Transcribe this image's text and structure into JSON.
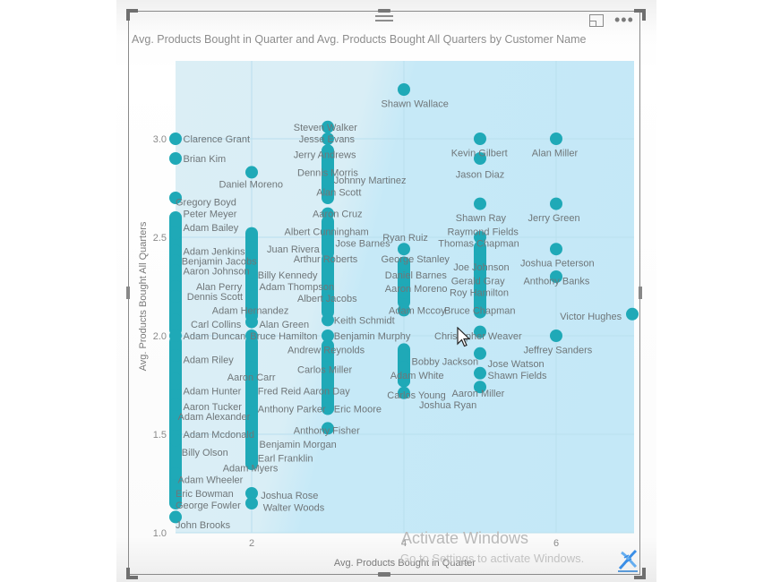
{
  "visual": {
    "title": "Avg. Products Bought in Quarter and Avg. Products Bought All Quarters by Customer Name",
    "header_icons": [
      "drag-handle-icon",
      "focus-mode-icon",
      "more-options-icon"
    ]
  },
  "watermark": {
    "line1": "Activate Windows",
    "line2": "Go to Settings to activate Windows."
  },
  "colors": {
    "marker": "#1fa9b7",
    "label": "#6f7679",
    "plot_background": "#c4e8f7"
  },
  "chart_data": {
    "type": "scatter",
    "title": "Avg. Products Bought in Quarter and Avg. Products Bought All Quarters by Customer Name",
    "xlabel": "Avg. Products Bought in Quarter",
    "ylabel": "Avg. Products Bought All Quarters",
    "xlim": [
      1,
      7
    ],
    "ylim": [
      1.0,
      3.3
    ],
    "x_ticks": [
      2,
      4,
      6
    ],
    "x_tick_labels": [
      "2",
      "4",
      "6"
    ],
    "y_ticks": [
      1.0,
      1.5,
      2.0,
      2.5,
      3.0
    ],
    "y_tick_labels": [
      "1.0",
      "1.5",
      "2.0",
      "2.5",
      "3.0"
    ],
    "grid": true,
    "legend": "none",
    "columns": [
      {
        "x": 1,
        "y_from": 2.03,
        "y_to": 2.6
      },
      {
        "x": 1,
        "y_from": 1.15,
        "y_to": 1.97
      },
      {
        "x": 2,
        "y_from": 2.1,
        "y_to": 2.52
      },
      {
        "x": 2,
        "y_from": 1.35,
        "y_to": 1.97
      },
      {
        "x": 3,
        "y_from": 2.7,
        "y_to": 2.92
      },
      {
        "x": 3,
        "y_from": 2.12,
        "y_to": 2.38
      },
      {
        "x": 3,
        "y_from": 1.63,
        "y_to": 1.95
      },
      {
        "x": 3,
        "y_from": 2.42,
        "y_to": 2.58
      },
      {
        "x": 4,
        "y_from": 2.17,
        "y_to": 2.37
      },
      {
        "x": 4,
        "y_from": 1.77,
        "y_to": 1.93
      },
      {
        "x": 5,
        "y_from": 2.12,
        "y_to": 2.45
      }
    ],
    "points": [
      {
        "name": "Clarence Grant",
        "x": 1,
        "y": 3.0
      },
      {
        "name": "Brian Kim",
        "x": 1,
        "y": 2.9
      },
      {
        "name": "Gregory Boyd",
        "x": 1,
        "y": 2.7
      },
      {
        "name": "Peter Meyer",
        "x": 1,
        "y": 2.58
      },
      {
        "name": "Adam Bailey",
        "x": 1,
        "y": 2.52
      },
      {
        "name": "Adam Jenkins",
        "x": 1,
        "y": 2.43
      },
      {
        "name": "Benjamin Jacobs",
        "x": 1,
        "y": 2.38
      },
      {
        "name": "Aaron Johnson",
        "x": 1,
        "y": 2.33
      },
      {
        "name": "Alan Perry",
        "x": 1,
        "y": 2.25
      },
      {
        "name": "Dennis Scott",
        "x": 1,
        "y": 2.2
      },
      {
        "name": "Adam Hernandez",
        "x": 2,
        "y": 2.13
      },
      {
        "name": "Carl Collins",
        "x": 1,
        "y": 2.08
      },
      {
        "name": "Adam Duncan",
        "x": 1,
        "y": 2.0
      },
      {
        "name": "Adam Riley",
        "x": 1,
        "y": 1.9
      },
      {
        "name": "Aaron Carr",
        "x": 2,
        "y": 1.84
      },
      {
        "name": "Adam Hunter",
        "x": 1,
        "y": 1.78
      },
      {
        "name": "Aaron Tucker",
        "x": 1,
        "y": 1.7
      },
      {
        "name": "Adam Alexander",
        "x": 1,
        "y": 1.65
      },
      {
        "name": "Adam Mcdonald",
        "x": 1,
        "y": 1.55
      },
      {
        "name": "Billy Olson",
        "x": 1,
        "y": 1.47
      },
      {
        "name": "Adam Myers",
        "x": 2,
        "y": 1.37
      },
      {
        "name": "Adam Wheeler",
        "x": 1,
        "y": 1.3
      },
      {
        "name": "Eric Bowman",
        "x": 1,
        "y": 1.24
      },
      {
        "name": "George Fowler",
        "x": 1,
        "y": 1.17
      },
      {
        "name": "John Brooks",
        "x": 1,
        "y": 1.08
      },
      {
        "name": "Daniel Moreno",
        "x": 2,
        "y": 2.83
      },
      {
        "name": "Juan Rivera",
        "x": 2,
        "y": 2.45
      },
      {
        "name": "Billy Kennedy",
        "x": 2,
        "y": 2.33
      },
      {
        "name": "Adam Thompson",
        "x": 2,
        "y": 2.26
      },
      {
        "name": "Alan Green",
        "x": 2,
        "y": 2.07
      },
      {
        "name": "Bruce Hamilton",
        "x": 2,
        "y": 2.0
      },
      {
        "name": "Fred Reid",
        "x": 2,
        "y": 1.78
      },
      {
        "name": "Anthony Parker",
        "x": 2,
        "y": 1.67
      },
      {
        "name": "Benjamin Morgan",
        "x": 2,
        "y": 1.46
      },
      {
        "name": "Earl Franklin",
        "x": 2,
        "y": 1.4
      },
      {
        "name": "Joshua Rose",
        "x": 2,
        "y": 1.2
      },
      {
        "name": "Walter Woods",
        "x": 2,
        "y": 1.15
      },
      {
        "name": "Steven Walker",
        "x": 3,
        "y": 3.06
      },
      {
        "name": "Jesse Evans",
        "x": 3,
        "y": 3.0
      },
      {
        "name": "Jerry Andrews",
        "x": 3,
        "y": 2.94
      },
      {
        "name": "Dennis Morris",
        "x": 3,
        "y": 2.86
      },
      {
        "name": "Johnny Martinez",
        "x": 3,
        "y": 2.79
      },
      {
        "name": "Alan Scott",
        "x": 3,
        "y": 2.72
      },
      {
        "name": "Aaron Cruz",
        "x": 3,
        "y": 2.62
      },
      {
        "name": "Albert Cunningham",
        "x": 3,
        "y": 2.53
      },
      {
        "name": "Jose Barnes",
        "x": 3,
        "y": 2.46
      },
      {
        "name": "Arthur Roberts",
        "x": 3,
        "y": 2.39
      },
      {
        "name": "Albert Jacobs",
        "x": 3,
        "y": 2.19
      },
      {
        "name": "Keith Schmidt",
        "x": 3,
        "y": 2.08
      },
      {
        "name": "Benjamin Murphy",
        "x": 3,
        "y": 2.0
      },
      {
        "name": "Andrew Reynolds",
        "x": 3,
        "y": 1.94
      },
      {
        "name": "Carlos Miller",
        "x": 3,
        "y": 1.84
      },
      {
        "name": "Aaron Day",
        "x": 3,
        "y": 1.72
      },
      {
        "name": "Eric Moore",
        "x": 3,
        "y": 1.63
      },
      {
        "name": "Anthony Fisher",
        "x": 3,
        "y": 1.53
      },
      {
        "name": "Shawn Wallace",
        "x": 4,
        "y": 3.25
      },
      {
        "name": "Ryan Ruiz",
        "x": 4,
        "y": 2.44
      },
      {
        "name": "George Stanley",
        "x": 4,
        "y": 2.37
      },
      {
        "name": "Daniel Barnes",
        "x": 4,
        "y": 2.29
      },
      {
        "name": "Aaron Moreno",
        "x": 4,
        "y": 2.22
      },
      {
        "name": "Adam Mccoy",
        "x": 4,
        "y": 2.13
      },
      {
        "name": "Bobby Jackson",
        "x": 4,
        "y": 1.9
      },
      {
        "name": "Adam White",
        "x": 4,
        "y": 1.84
      },
      {
        "name": "Carlos Young",
        "x": 4,
        "y": 1.77
      },
      {
        "name": "Joshua Ryan",
        "x": 4,
        "y": 1.71
      },
      {
        "name": "Kevin Gilbert",
        "x": 5,
        "y": 3.0
      },
      {
        "name": "Jason Diaz",
        "x": 5,
        "y": 2.9
      },
      {
        "name": "Shawn Ray",
        "x": 5,
        "y": 2.67
      },
      {
        "name": "Raymond Fields",
        "x": 5,
        "y": 2.5
      },
      {
        "name": "Thomas Chapman",
        "x": 5,
        "y": 2.44
      },
      {
        "name": "Joe Johnson",
        "x": 5,
        "y": 2.33
      },
      {
        "name": "Gerald Gray",
        "x": 5,
        "y": 2.26
      },
      {
        "name": "Roy Hamilton",
        "x": 5,
        "y": 2.21
      },
      {
        "name": "Bruce Chapman",
        "x": 5,
        "y": 2.13
      },
      {
        "name": "Christopher Weaver",
        "x": 5,
        "y": 2.02
      },
      {
        "name": "Jose Watson",
        "x": 5,
        "y": 1.91
      },
      {
        "name": "Shawn Fields",
        "x": 5,
        "y": 1.81
      },
      {
        "name": "Aaron Miller",
        "x": 5,
        "y": 1.74
      },
      {
        "name": "Alan Miller",
        "x": 6,
        "y": 3.0
      },
      {
        "name": "Jerry Green",
        "x": 6,
        "y": 2.67
      },
      {
        "name": "Joshua Peterson",
        "x": 6,
        "y": 2.44
      },
      {
        "name": "Anthony Banks",
        "x": 6,
        "y": 2.3
      },
      {
        "name": "Jeffrey Sanders",
        "x": 6,
        "y": 2.0
      },
      {
        "name": "Victor Hughes",
        "x": 7,
        "y": 2.11
      }
    ],
    "labels": [
      {
        "name": "Clarence Grant",
        "lx": 1.1,
        "ly": 3.0,
        "anchor": "start"
      },
      {
        "name": "Brian Kim",
        "lx": 1.1,
        "ly": 2.9,
        "anchor": "start"
      },
      {
        "name": "Gregory Boyd",
        "lx": 1.0,
        "ly": 2.68,
        "anchor": "start"
      },
      {
        "name": "Peter Meyer",
        "lx": 1.1,
        "ly": 2.62,
        "anchor": "start"
      },
      {
        "name": "Adam Bailey",
        "lx": 1.1,
        "ly": 2.55,
        "anchor": "start"
      },
      {
        "name": "Adam Jenkins",
        "lx": 1.1,
        "ly": 2.43,
        "anchor": "start"
      },
      {
        "name": "Benjamin Jacobs",
        "lx": 1.08,
        "ly": 2.38,
        "anchor": "start"
      },
      {
        "name": "Aaron Johnson",
        "lx": 1.1,
        "ly": 2.33,
        "anchor": "start"
      },
      {
        "name": "Alan Perry",
        "lx": 1.27,
        "ly": 2.25,
        "anchor": "start"
      },
      {
        "name": "Dennis Scott",
        "lx": 1.15,
        "ly": 2.2,
        "anchor": "start"
      },
      {
        "name": "Adam Hernandez",
        "lx": 1.48,
        "ly": 2.13,
        "anchor": "start"
      },
      {
        "name": "Carl Collins",
        "lx": 1.2,
        "ly": 2.06,
        "anchor": "start"
      },
      {
        "name": "Adam Duncan",
        "lx": 1.1,
        "ly": 2.0,
        "anchor": "start"
      },
      {
        "name": "Adam Riley",
        "lx": 1.1,
        "ly": 1.88,
        "anchor": "start"
      },
      {
        "name": "Aaron Carr",
        "lx": 1.68,
        "ly": 1.79,
        "anchor": "start"
      },
      {
        "name": "Adam Hunter",
        "lx": 1.1,
        "ly": 1.72,
        "anchor": "start"
      },
      {
        "name": "Aaron Tucker",
        "lx": 1.1,
        "ly": 1.64,
        "anchor": "start"
      },
      {
        "name": "Adam Alexander",
        "lx": 1.03,
        "ly": 1.59,
        "anchor": "start"
      },
      {
        "name": "Adam Mcdonald",
        "lx": 1.1,
        "ly": 1.5,
        "anchor": "start"
      },
      {
        "name": "Billy Olson",
        "lx": 1.08,
        "ly": 1.41,
        "anchor": "start"
      },
      {
        "name": "Adam Myers",
        "lx": 1.62,
        "ly": 1.33,
        "anchor": "start"
      },
      {
        "name": "Adam Wheeler",
        "lx": 1.03,
        "ly": 1.27,
        "anchor": "start"
      },
      {
        "name": "Eric Bowman",
        "lx": 1.0,
        "ly": 1.2,
        "anchor": "start"
      },
      {
        "name": "George Fowler",
        "lx": 1.0,
        "ly": 1.14,
        "anchor": "start"
      },
      {
        "name": "John Brooks",
        "lx": 1.0,
        "ly": 1.04,
        "anchor": "start"
      },
      {
        "name": "Daniel Moreno",
        "lx": 1.57,
        "ly": 2.77,
        "anchor": "start"
      },
      {
        "name": "Juan Rivera",
        "lx": 2.2,
        "ly": 2.44,
        "anchor": "start"
      },
      {
        "name": "Billy Kennedy",
        "lx": 2.08,
        "ly": 2.31,
        "anchor": "start"
      },
      {
        "name": "Adam Thompson",
        "lx": 2.1,
        "ly": 2.25,
        "anchor": "start"
      },
      {
        "name": "Alan Green",
        "lx": 2.1,
        "ly": 2.06,
        "anchor": "start"
      },
      {
        "name": "Bruce Hamilton",
        "lx": 1.98,
        "ly": 2.0,
        "anchor": "start"
      },
      {
        "name": "Fred Reid",
        "lx": 2.08,
        "ly": 1.72,
        "anchor": "start"
      },
      {
        "name": "Anthony Parker",
        "lx": 2.08,
        "ly": 1.63,
        "anchor": "start"
      },
      {
        "name": "Benjamin Morgan",
        "lx": 2.1,
        "ly": 1.45,
        "anchor": "start"
      },
      {
        "name": "Earl Franklin",
        "lx": 2.08,
        "ly": 1.38,
        "anchor": "start"
      },
      {
        "name": "Joshua Rose",
        "lx": 2.12,
        "ly": 1.19,
        "anchor": "start"
      },
      {
        "name": "Walter Woods",
        "lx": 2.15,
        "ly": 1.13,
        "anchor": "start"
      },
      {
        "name": "Steven Walker",
        "lx": 2.55,
        "ly": 3.06,
        "anchor": "start"
      },
      {
        "name": "Jesse Evans",
        "lx": 2.62,
        "ly": 3.0,
        "anchor": "start"
      },
      {
        "name": "Jerry Andrews",
        "lx": 2.55,
        "ly": 2.92,
        "anchor": "start"
      },
      {
        "name": "Dennis Morris",
        "lx": 2.6,
        "ly": 2.83,
        "anchor": "start"
      },
      {
        "name": "Johnny Martinez",
        "lx": 3.08,
        "ly": 2.79,
        "anchor": "start"
      },
      {
        "name": "Alan Scott",
        "lx": 2.85,
        "ly": 2.73,
        "anchor": "start"
      },
      {
        "name": "Aaron Cruz",
        "lx": 2.8,
        "ly": 2.62,
        "anchor": "start"
      },
      {
        "name": "Albert Cunningham",
        "lx": 2.43,
        "ly": 2.53,
        "anchor": "start"
      },
      {
        "name": "Jose Barnes",
        "lx": 3.1,
        "ly": 2.47,
        "anchor": "start"
      },
      {
        "name": "Arthur Roberts",
        "lx": 2.55,
        "ly": 2.39,
        "anchor": "start"
      },
      {
        "name": "Albert Jacobs",
        "lx": 2.6,
        "ly": 2.19,
        "anchor": "start"
      },
      {
        "name": "Keith Schmidt",
        "lx": 3.08,
        "ly": 2.08,
        "anchor": "start"
      },
      {
        "name": "Benjamin Murphy",
        "lx": 3.08,
        "ly": 2.0,
        "anchor": "start"
      },
      {
        "name": "Andrew Reynolds",
        "lx": 2.47,
        "ly": 1.93,
        "anchor": "start"
      },
      {
        "name": "Carlos Miller",
        "lx": 2.6,
        "ly": 1.83,
        "anchor": "start"
      },
      {
        "name": "Aaron Day",
        "lx": 2.68,
        "ly": 1.72,
        "anchor": "start"
      },
      {
        "name": "Eric Moore",
        "lx": 3.08,
        "ly": 1.63,
        "anchor": "start"
      },
      {
        "name": "Anthony Fisher",
        "lx": 2.55,
        "ly": 1.52,
        "anchor": "start"
      },
      {
        "name": "Shawn Wallace",
        "lx": 3.7,
        "ly": 3.18,
        "anchor": "start"
      },
      {
        "name": "Ryan Ruiz",
        "lx": 3.72,
        "ly": 2.5,
        "anchor": "start"
      },
      {
        "name": "George Stanley",
        "lx": 3.7,
        "ly": 2.39,
        "anchor": "start"
      },
      {
        "name": "Daniel Barnes",
        "lx": 3.75,
        "ly": 2.31,
        "anchor": "start"
      },
      {
        "name": "Aaron Moreno",
        "lx": 3.75,
        "ly": 2.24,
        "anchor": "start"
      },
      {
        "name": "Adam Mccoy",
        "lx": 3.8,
        "ly": 2.13,
        "anchor": "start"
      },
      {
        "name": "Bobby Jackson",
        "lx": 4.1,
        "ly": 1.87,
        "anchor": "start"
      },
      {
        "name": "Adam White",
        "lx": 3.82,
        "ly": 1.8,
        "anchor": "start"
      },
      {
        "name": "Carlos Young",
        "lx": 3.78,
        "ly": 1.7,
        "anchor": "start"
      },
      {
        "name": "Joshua Ryan",
        "lx": 4.2,
        "ly": 1.65,
        "anchor": "start"
      },
      {
        "name": "Kevin Gilbert",
        "lx": 4.62,
        "ly": 2.93,
        "anchor": "start"
      },
      {
        "name": "Jason Diaz",
        "lx": 4.68,
        "ly": 2.82,
        "anchor": "start"
      },
      {
        "name": "Shawn Ray",
        "lx": 4.68,
        "ly": 2.6,
        "anchor": "start"
      },
      {
        "name": "Raymond Fields",
        "lx": 4.57,
        "ly": 2.53,
        "anchor": "start"
      },
      {
        "name": "Thomas Chapman",
        "lx": 4.45,
        "ly": 2.47,
        "anchor": "start"
      },
      {
        "name": "Joe Johnson",
        "lx": 4.65,
        "ly": 2.35,
        "anchor": "start"
      },
      {
        "name": "Gerald Gray",
        "lx": 4.62,
        "ly": 2.28,
        "anchor": "start"
      },
      {
        "name": "Roy Hamilton",
        "lx": 4.6,
        "ly": 2.22,
        "anchor": "start"
      },
      {
        "name": "Bruce Chapman",
        "lx": 4.53,
        "ly": 2.13,
        "anchor": "start"
      },
      {
        "name": "Christopher Weaver",
        "lx": 4.4,
        "ly": 2.0,
        "anchor": "start"
      },
      {
        "name": "Jose Watson",
        "lx": 5.1,
        "ly": 1.86,
        "anchor": "start"
      },
      {
        "name": "Shawn Fields",
        "lx": 5.1,
        "ly": 1.8,
        "anchor": "start"
      },
      {
        "name": "Aaron Miller",
        "lx": 4.63,
        "ly": 1.71,
        "anchor": "start"
      },
      {
        "name": "Alan Miller",
        "lx": 5.68,
        "ly": 2.93,
        "anchor": "start"
      },
      {
        "name": "Jerry Green",
        "lx": 5.63,
        "ly": 2.6,
        "anchor": "start"
      },
      {
        "name": "Joshua Peterson",
        "lx": 5.53,
        "ly": 2.37,
        "anchor": "start"
      },
      {
        "name": "Anthony Banks",
        "lx": 5.57,
        "ly": 2.28,
        "anchor": "start"
      },
      {
        "name": "Victor Hughes",
        "lx": 6.05,
        "ly": 2.1,
        "anchor": "start"
      },
      {
        "name": "Jeffrey Sanders",
        "lx": 5.57,
        "ly": 1.93,
        "anchor": "start"
      }
    ]
  }
}
